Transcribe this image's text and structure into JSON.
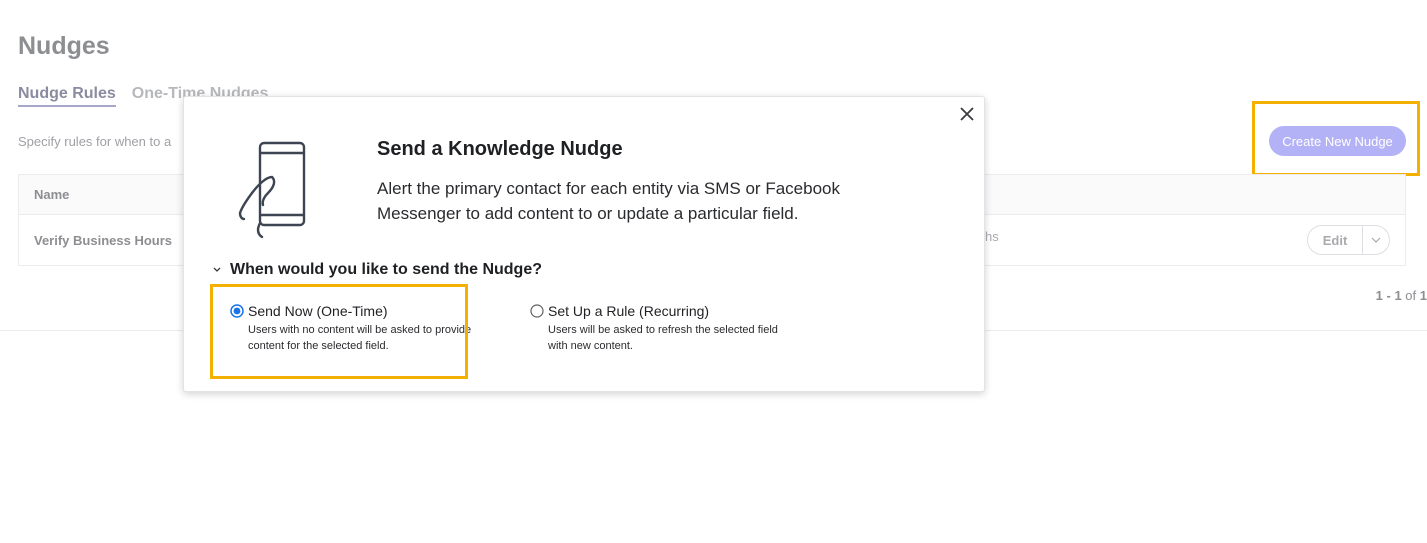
{
  "page": {
    "title": "Nudges",
    "tabs": [
      {
        "label": "Nudge Rules",
        "active": true
      },
      {
        "label": "One-Time Nudges",
        "active": false
      }
    ],
    "description": "Specify rules for when to a",
    "create_button": "Create New Nudge",
    "table": {
      "headers": [
        "Name"
      ],
      "rows": [
        {
          "name": "Verify Business Hours",
          "trailing": "hs",
          "edit_label": "Edit"
        }
      ]
    },
    "pagination": {
      "range": "1 - 1",
      "of": "of",
      "total": "1"
    }
  },
  "modal": {
    "title": "Send a Knowledge Nudge",
    "description": "Alert the primary contact for each entity via SMS or Facebook Messenger to add content to or update a particular field.",
    "question": "When would you like to send the Nudge?",
    "options": [
      {
        "title": "Send Now (One-Time)",
        "subtitle": "Users with no content will be asked to provide content for the selected field.",
        "selected": true
      },
      {
        "title": "Set Up a Rule (Recurring)",
        "subtitle": "Users will be asked to refresh the selected field with new content.",
        "selected": false
      }
    ]
  },
  "colors": {
    "highlight": "#f4b000",
    "create_button": "#b4b2f6",
    "radio_selected": "#1a73e8"
  },
  "icons": [
    "close-icon",
    "phone-in-hand-icon",
    "chevron-down-icon"
  ]
}
